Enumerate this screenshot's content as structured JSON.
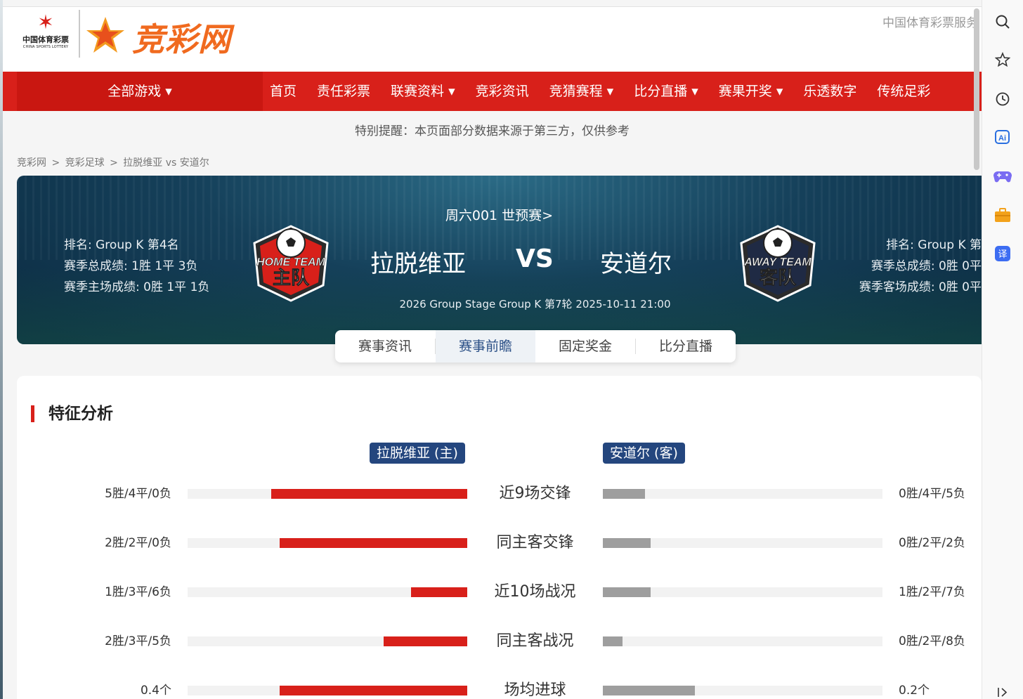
{
  "header": {
    "lottery_logo_cn": "中国体育彩票",
    "lottery_logo_en": "CHINA SPORTS LOTTERY",
    "site_logo": "竞彩网",
    "service_link": "中国体育彩票服务"
  },
  "nav": {
    "all_games": "全部游戏 ▾",
    "items": [
      "首页",
      "责任彩票",
      "联赛资料 ▾",
      "竞彩资讯",
      "竞猜赛程 ▾",
      "比分直播 ▾",
      "赛果开奖 ▾",
      "乐透数字",
      "传统足彩"
    ]
  },
  "notice": "特别提醒：本页面部分数据来源于第三方，仅供参考",
  "breadcrumb": [
    "竞彩网",
    ">",
    "竞彩足球",
    ">",
    "拉脱维亚 vs 安道尔"
  ],
  "match": {
    "header": "周六001 世预赛>",
    "home_team": "拉脱维亚",
    "vs": "VS",
    "away_team": "安道尔",
    "meta": "2026 Group Stage Group K 第7轮 2025-10-11 21:00",
    "home_badge_line1": "HOME TEAM",
    "home_badge_line2": "主队",
    "away_badge_line1": "AWAY TEAM",
    "away_badge_line2": "客队",
    "home_info": [
      "排名: Group K 第4名",
      "赛季总成绩: 1胜 1平 3负",
      "赛季主场成绩: 0胜 1平 1负"
    ],
    "away_info": [
      "排名: Group K 第",
      "赛季总成绩: 0胜 0平",
      "赛季客场成绩: 0胜 0平"
    ]
  },
  "tabs": [
    {
      "label": "赛事资讯",
      "active": false
    },
    {
      "label": "赛事前瞻",
      "active": true
    },
    {
      "label": "固定奖金",
      "active": false
    },
    {
      "label": "比分直播",
      "active": false
    }
  ],
  "analysis": {
    "title": "特征分析",
    "home_tag": "拉脱维亚 (主)",
    "away_tag": "安道尔 (客)",
    "rows": [
      {
        "label": "近9场交锋",
        "home_value": "5胜/4平/0负",
        "home_ratio": 0.7,
        "away_value": "0胜/4平/5负",
        "away_ratio": 0.15
      },
      {
        "label": "同主客交锋",
        "home_value": "2胜/2平/0负",
        "home_ratio": 0.67,
        "away_value": "0胜/2平/2负",
        "away_ratio": 0.17
      },
      {
        "label": "近10场战况",
        "home_value": "1胜/3平/6负",
        "home_ratio": 0.2,
        "away_value": "1胜/2平/7负",
        "away_ratio": 0.17
      },
      {
        "label": "同主客战况",
        "home_value": "2胜/3平/5负",
        "home_ratio": 0.3,
        "away_value": "0胜/2平/8负",
        "away_ratio": 0.07
      },
      {
        "label": "场均进球",
        "home_value": "0.4个",
        "home_ratio": 0.67,
        "away_value": "0.2个",
        "away_ratio": 0.33
      }
    ]
  },
  "sidebar_icons": [
    "search-icon",
    "star-icon",
    "history-icon",
    "ai-icon",
    "game-controller-icon",
    "toolbox-icon",
    "translate-icon",
    "expand-icon"
  ],
  "colors": {
    "brand_red": "#d8201a",
    "tag_blue": "#24467e",
    "away_bar": "#9e9e9e"
  }
}
